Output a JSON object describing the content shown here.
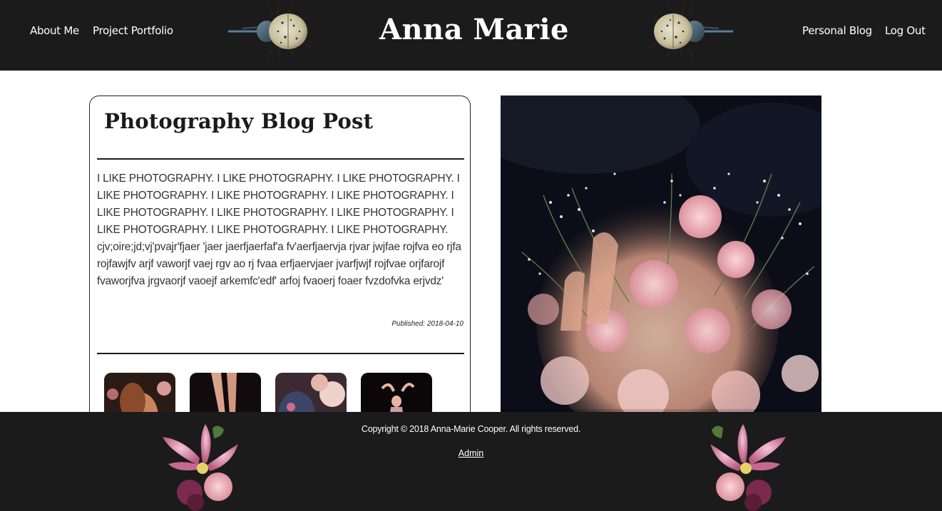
{
  "header": {
    "title": "Anna Marie",
    "nav_left": [
      {
        "label": "About Me"
      },
      {
        "label": "Project Portfolio"
      }
    ],
    "nav_right": [
      {
        "label": "Personal Blog"
      },
      {
        "label": "Log Out"
      }
    ]
  },
  "post": {
    "title": "Photography Blog Post",
    "body": "I LIKE PHOTOGRAPHY. I LIKE PHOTOGRAPHY. I LIKE PHOTOGRAPHY. I LIKE PHOTOGRAPHY. I LIKE PHOTOGRAPHY. I LIKE PHOTOGRAPHY. I LIKE PHOTOGRAPHY. I LIKE PHOTOGRAPHY. I LIKE PHOTOGRAPHY. I LIKE PHOTOGRAPHY. I LIKE PHOTOGRAPHY. I LIKE PHOTOGRAPHY. cjv;oire;jd;vj'pvajr'fjaer 'jaer jaerfjaerfaf'a fv'aerfjaervja rjvar jwjfae rojfva eo rjfa rojfawjfv arjf vaworjf vaej rgv ao rj fvaa erfjaervjaer jvarfjwjf rojfvae orjfarojf fvaworjfva jrgvaorjf vaoejf arkemfc'edf' arfoj fvaoerj foaer fvzdofvka erjvdz'",
    "published": "Published: 2018-04-10"
  },
  "footer": {
    "copyright": "Copyright © 2018 Anna-Marie Cooper. All rights reserved.",
    "admin_label": "Admin"
  },
  "colors": {
    "header_bg": "#1b1b1b",
    "footer_bg": "#1b1b1b",
    "text_dark": "#1b1b1b"
  }
}
